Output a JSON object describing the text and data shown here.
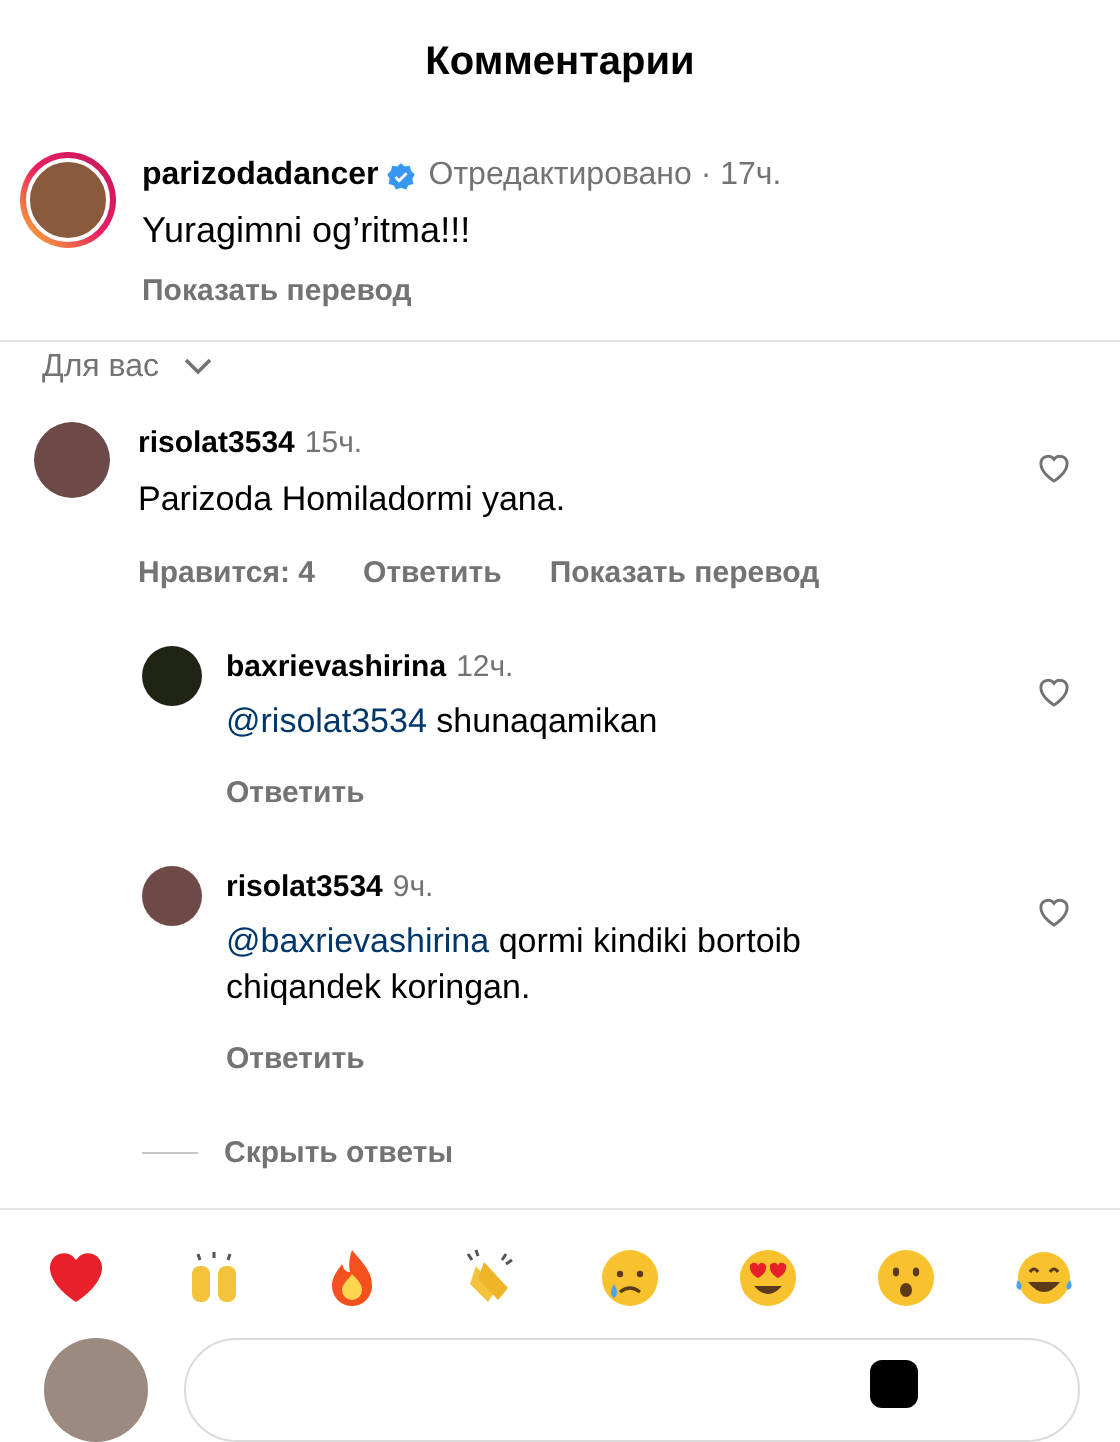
{
  "title": "Комментарии",
  "post": {
    "username": "parizodadancer",
    "verified": true,
    "meta": "Отредактировано · 17ч.",
    "text": "Yuragimni og’ritma!!!",
    "translate": "Показать перевод"
  },
  "filter": {
    "label": "Для вас"
  },
  "comments": [
    {
      "username": "risolat3534",
      "time": "15ч.",
      "text": "Parizoda Homiladormi yana.",
      "liked": false,
      "actions": [
        "Нравится: 4",
        "Ответить",
        "Показать перевод"
      ],
      "replies": [
        {
          "username": "baxrievashirina",
          "time": "12ч.",
          "mention": "@risolat3534",
          "text": "shunaqamikan",
          "liked": false,
          "actions": [
            "Ответить"
          ]
        },
        {
          "username": "risolat3534",
          "time": "9ч.",
          "mention": "@baxrievashirina",
          "text": "qormi kindiki bortoib chiqandek koringan.",
          "liked": false,
          "actions": [
            "Ответить"
          ]
        }
      ],
      "hide_replies": "Скрыть ответы"
    }
  ]
}
